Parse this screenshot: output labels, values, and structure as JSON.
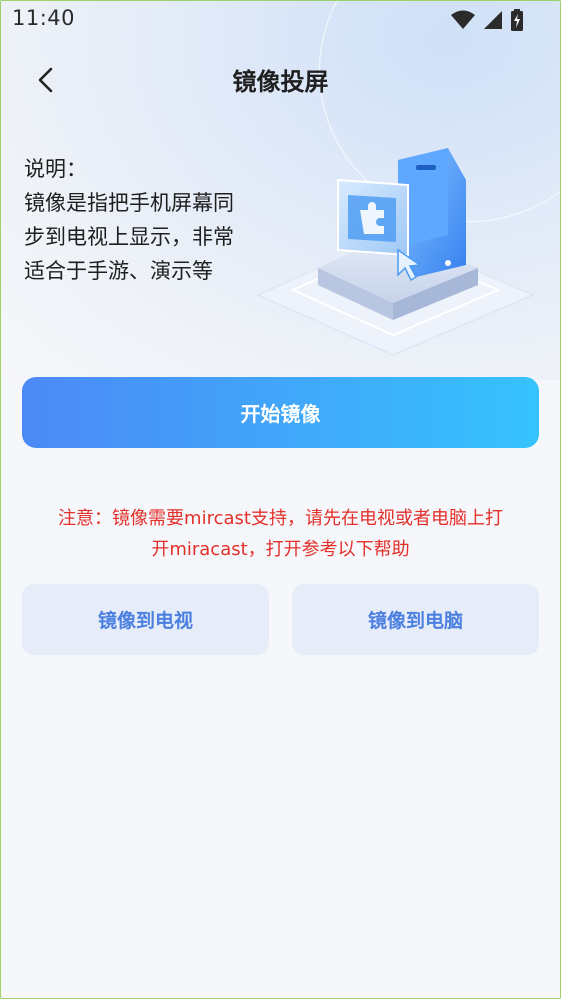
{
  "status_bar": {
    "time": "11:40",
    "icons": [
      "wifi-icon",
      "signal-icon",
      "battery-icon"
    ]
  },
  "header": {
    "title": "镜像投屏",
    "back_icon": "chevron-left-icon"
  },
  "description": {
    "heading": "说明：",
    "body": "镜像是指把手机屏幕同步到电视上显示，非常适合于手游、演示等"
  },
  "start_button": {
    "label": "开始镜像"
  },
  "notice": {
    "text": "注意：镜像需要mircast支持，请先在电视或者电脑上打开miracast，打开参考以下帮助"
  },
  "help_buttons": {
    "tv_label": "镜像到电视",
    "pc_label": "镜像到电脑"
  },
  "colors": {
    "accent_start": "#4c89f6",
    "accent_end": "#36c3fd",
    "notice_red": "#e3302b",
    "secondary_bg": "#e6ecf8",
    "secondary_text": "#4b7fe0"
  }
}
